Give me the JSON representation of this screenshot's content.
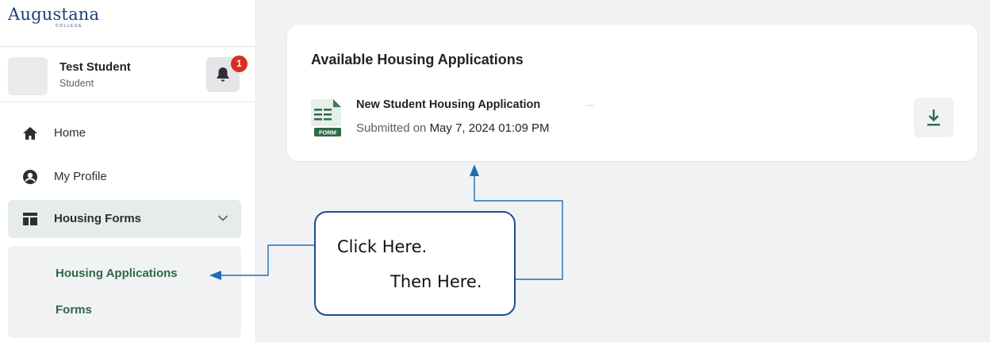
{
  "brand": {
    "logo_main": "Augustana",
    "logo_sub": "COLLEGE"
  },
  "user": {
    "name": "Test Student",
    "role": "Student",
    "notifications": "1"
  },
  "nav": {
    "home": "Home",
    "profile": "My Profile",
    "housing_forms": "Housing Forms",
    "sub_items": [
      "Housing Applications",
      "Forms"
    ]
  },
  "card": {
    "title": "Available Housing Applications",
    "application": {
      "name": "New Student Housing Application",
      "submitted_prefix": "Submitted on",
      "submitted_date": "May 7, 2024 01:09 PM",
      "icon_label": "FORM"
    }
  },
  "annotation": {
    "line1": "Click Here.",
    "line2": "Then Here."
  },
  "colors": {
    "brand_blue": "#1d3f7a",
    "accent_green": "#2e6a45",
    "badge_red": "#d92d20",
    "callout_border": "#1f4d8c",
    "arrow_blue": "#1e6fb8"
  }
}
